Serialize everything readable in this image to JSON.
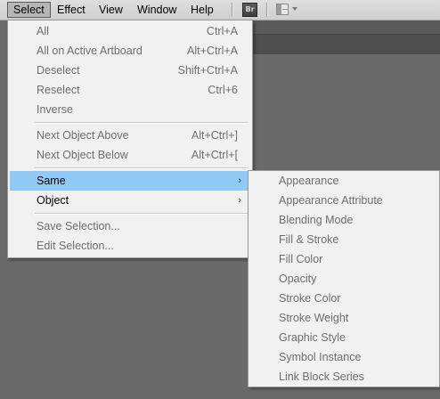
{
  "menubar": {
    "items": [
      "Select",
      "Effect",
      "View",
      "Window",
      "Help"
    ],
    "bridge_label": "Br"
  },
  "select_menu": {
    "items": [
      {
        "label": "All",
        "shortcut": "Ctrl+A",
        "enabled": false
      },
      {
        "label": "All on Active Artboard",
        "shortcut": "Alt+Ctrl+A",
        "enabled": false
      },
      {
        "label": "Deselect",
        "shortcut": "Shift+Ctrl+A",
        "enabled": false
      },
      {
        "label": "Reselect",
        "shortcut": "Ctrl+6",
        "enabled": false
      },
      {
        "label": "Inverse",
        "shortcut": "",
        "enabled": false
      },
      {
        "label": "Next Object Above",
        "shortcut": "Alt+Ctrl+]",
        "enabled": false
      },
      {
        "label": "Next Object Below",
        "shortcut": "Alt+Ctrl+[",
        "enabled": false
      },
      {
        "label": "Same",
        "shortcut": "",
        "enabled": true,
        "highlighted": true,
        "submenu": true
      },
      {
        "label": "Object",
        "shortcut": "",
        "enabled": true,
        "submenu": true
      },
      {
        "label": "Save Selection...",
        "shortcut": "",
        "enabled": false
      },
      {
        "label": "Edit Selection...",
        "shortcut": "",
        "enabled": false
      }
    ]
  },
  "same_submenu": {
    "items": [
      "Appearance",
      "Appearance Attribute",
      "Blending Mode",
      "Fill & Stroke",
      "Fill Color",
      "Opacity",
      "Stroke Color",
      "Stroke Weight",
      "Graphic Style",
      "Symbol Instance",
      "Link Block Series"
    ]
  },
  "colors": {
    "highlight": "#91c9f7",
    "menu_bg": "#f1f1f1",
    "workspace_bg": "#6a6a6a",
    "disabled_text": "#6e6e6e"
  }
}
